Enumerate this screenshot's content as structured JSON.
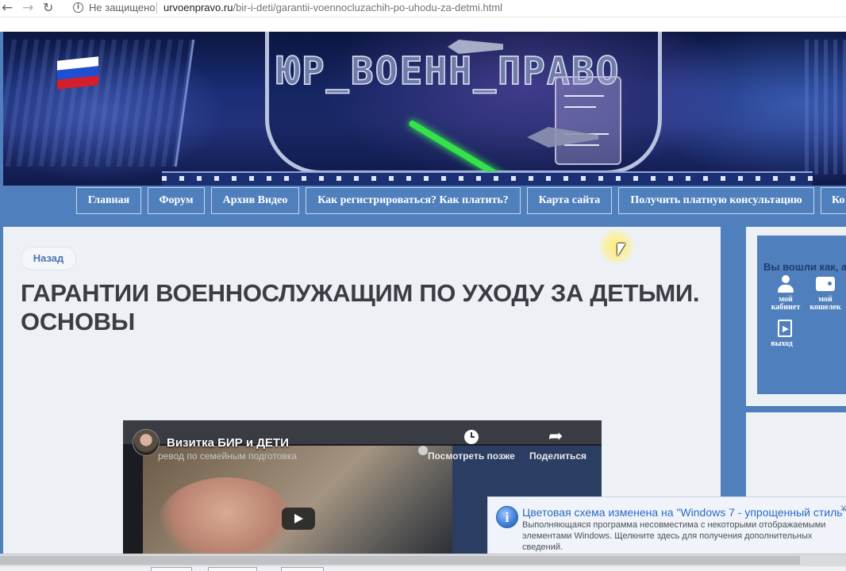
{
  "browser": {
    "security_label": "Не защищено",
    "url_domain": "urvoenpravo.ru",
    "url_path": "/bir-i-deti/garantii-voennocluzachih-po-uhodu-za-detmi.html",
    "back_icon": "←",
    "forward_icon": "→",
    "reload_icon": "↻",
    "info_icon": "i"
  },
  "banner": {
    "logo_text": "ЮР_ВОЕНН_ПРАВО",
    "flag_colors": [
      "#ffffff",
      "#1f4fd1",
      "#d41e2b"
    ]
  },
  "nav": {
    "items": [
      {
        "label": "Главная"
      },
      {
        "label": "Форум"
      },
      {
        "label": "Архив Видео"
      },
      {
        "label": "Как регистрироваться? Как платить?"
      },
      {
        "label": "Карта сайта"
      },
      {
        "label": "Получить платную консультацию"
      },
      {
        "label": "Ко"
      }
    ]
  },
  "content": {
    "back_label": "Назад",
    "title": "ГАРАНТИИ ВОЕННОСЛУЖАЩИМ ПО УХОДУ ЗА ДЕТЬМИ. ОСНОВЫ"
  },
  "video": {
    "title": "Визитка БИР и ДЕТИ",
    "subtitle": "ревод по семейным подготовка",
    "watch_later": "Посмотреть позже",
    "share": "Поделиться"
  },
  "sidebar": {
    "login_title": "Вы вошли как, а",
    "my_cabinet": "мой кабинет",
    "my_wallet": "мой кошелек",
    "logout": "выход"
  },
  "notification": {
    "title": "Цветовая схема изменена на \"Windows 7 - упрощенный стиль\"",
    "body": "Выполняющаяся программа несовместима с некоторыми отображаемыми элементами Windows.  Щелкните здесь для получения дополнительных сведений.",
    "close": "✕",
    "info_symbol": "i"
  },
  "colors": {
    "accent_blue": "#4f80bd",
    "panel_bg": "#edf1f5",
    "title_text": "#3a3d44",
    "notification_title": "#2a6bc6"
  }
}
